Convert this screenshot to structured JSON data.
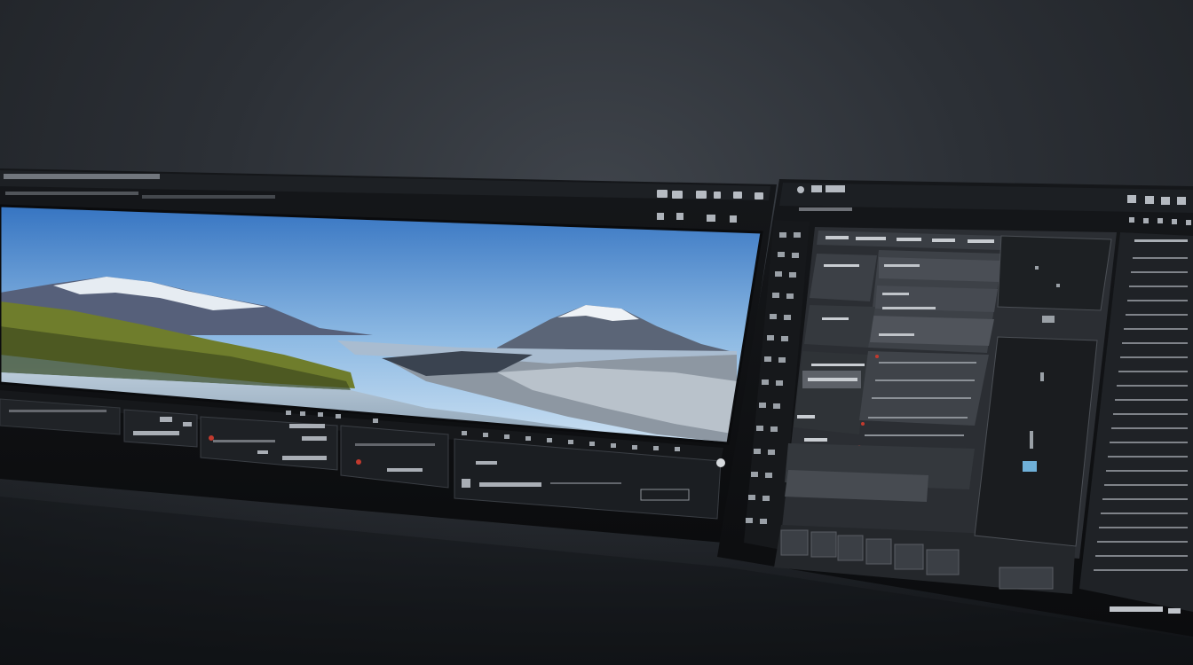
{
  "scene": {
    "description_label": "",
    "background_color": "#2c3036"
  },
  "left_monitor": {
    "preview_image": "mountain-lake-landscape",
    "bezel_color": "#0d0f12",
    "panel_color": "#1b1e22",
    "icons": [
      "window-controls-icon",
      "play-icon",
      "settings-icon"
    ]
  },
  "right_monitor": {
    "bezel_color": "#0c0e11",
    "panel_color": "#2a2d31",
    "icons": [
      "window-controls-icon",
      "gear-icon",
      "close-icon"
    ]
  },
  "colors": {
    "sky_top": "#2f6fbf",
    "sky_bottom": "#cfe3f3",
    "water": "#9fb4c6",
    "forest": "#6b7a2e",
    "snow": "#e9eef3",
    "mountain": "#4c5564",
    "accent_red": "#c23a2e"
  }
}
